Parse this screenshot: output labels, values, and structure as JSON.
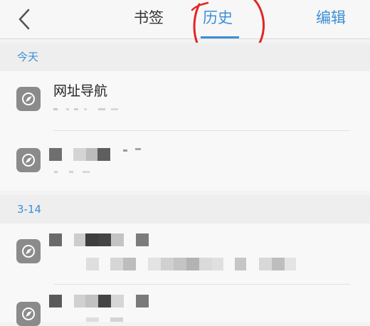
{
  "header": {
    "back_icon": "chevron-left-icon",
    "tabs": [
      {
        "label": "书签",
        "active": false
      },
      {
        "label": "历史",
        "active": true
      }
    ],
    "edit_label": "编辑"
  },
  "sections": [
    {
      "label": "今天",
      "items": [
        {
          "title": "网址导航",
          "icon": "globe-icon",
          "title_pixelated": false
        },
        {
          "title": "",
          "icon": "globe-icon",
          "title_pixelated": true
        }
      ]
    },
    {
      "label": "3-14",
      "items": [
        {
          "title": "",
          "icon": "globe-icon",
          "title_pixelated": true
        },
        {
          "title": "",
          "icon": "globe-icon",
          "title_pixelated": true
        }
      ]
    }
  ],
  "colors": {
    "accent": "#3a8fd8",
    "annotation": "#e12525",
    "icon_bg": "#8b8b8b"
  }
}
